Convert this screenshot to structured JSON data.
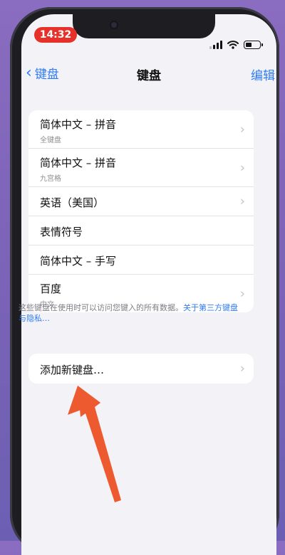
{
  "status": {
    "time": "14:32"
  },
  "nav": {
    "back_label": "键盘",
    "title": "键盘",
    "edit_label": "编辑"
  },
  "keyboards": [
    {
      "label": "简体中文 – 拼音",
      "sub": "全键盘"
    },
    {
      "label": "简体中文 – 拼音",
      "sub": "九宫格"
    },
    {
      "label": "英语（美国）",
      "sub": ""
    },
    {
      "label": "表情符号",
      "sub": ""
    },
    {
      "label": "简体中文 – 手写",
      "sub": ""
    },
    {
      "label": "百度",
      "sub": "中文"
    }
  ],
  "footnote": {
    "text": "这些键盘在使用时可以访问您键入的所有数据。",
    "link": "关于第三方键盘与隐私…"
  },
  "add_keyboard": {
    "label": "添加新键盘…"
  },
  "colors": {
    "accent": "#2f7bf6",
    "time_pill": "#e8302a",
    "arrow": "#ee5a2f"
  }
}
